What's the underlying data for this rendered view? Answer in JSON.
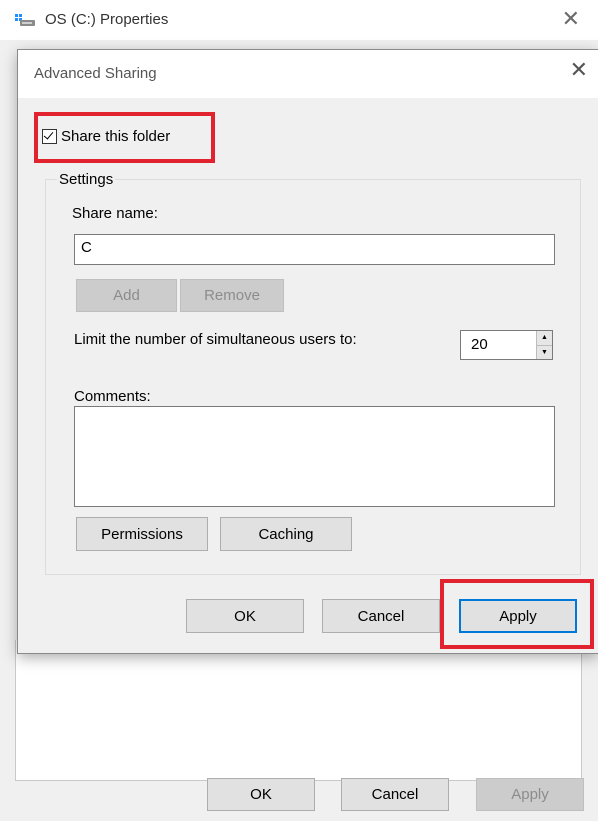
{
  "parent_window": {
    "title": "OS (C:) Properties",
    "buttons": {
      "ok": "OK",
      "cancel": "Cancel",
      "apply": "Apply"
    }
  },
  "dialog": {
    "title": "Advanced Sharing",
    "share_checkbox": {
      "label": "Share this folder",
      "checked": true
    },
    "settings": {
      "legend": "Settings",
      "share_name_label": "Share name:",
      "share_name_value": "C",
      "add_button": "Add",
      "remove_button": "Remove",
      "limit_label": "Limit the number of simultaneous users to:",
      "limit_value": "20",
      "comments_label": "Comments:",
      "comments_value": "",
      "permissions_button": "Permissions",
      "caching_button": "Caching"
    },
    "buttons": {
      "ok": "OK",
      "cancel": "Cancel",
      "apply": "Apply"
    }
  },
  "colors": {
    "highlight": "#e0232e",
    "dialog_bg": "#f0f0f0",
    "button_bg": "#e1e1e1"
  },
  "icons": {
    "parent_title": "drive-icon",
    "close": "close-icon"
  }
}
